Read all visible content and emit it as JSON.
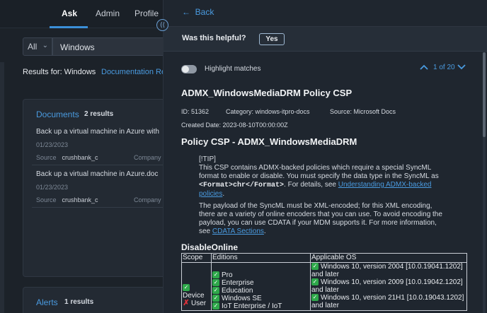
{
  "nav": {
    "tabs": [
      "Ask",
      "Admin",
      "Profile"
    ],
    "active_tab": "Ask"
  },
  "search": {
    "filter": "All",
    "query": "Windows"
  },
  "results": {
    "label": "Results for: Windows",
    "link": "Documentation Re"
  },
  "documents_panel": {
    "title": "Documents",
    "count": "2 results",
    "items": [
      {
        "title": "Back up a virtual machine in Azure with",
        "date": "01/23/2023",
        "source_label": "Source",
        "source": "crushbank_c",
        "company_label": "Company"
      },
      {
        "title": "Back up a virtual machine in Azure.doc",
        "date": "01/23/2023",
        "source_label": "Source",
        "source": "crushbank_c",
        "company_label": "Company"
      }
    ]
  },
  "alerts_panel": {
    "title": "Alerts",
    "count": "1 results"
  },
  "drawer": {
    "back_label": "Back",
    "helpful_question": "Was this helpful?",
    "yes_label": "Yes",
    "highlight_label": "Highlight matches",
    "highlight_on": false,
    "match_position": "1 of 20",
    "doc_title": "ADMX_WindowsMediaDRM Policy CSP",
    "id_text": "ID: 51362",
    "category_text": "Category: windows-itpro-docs",
    "source_text": "Source: Microsoft Docs",
    "created_text": "Created Date: 2023-08-10T00:00:00Z",
    "csp_title": "Policy CSP - ADMX_WindowsMediaDRM",
    "tip": "[!TIP]",
    "para1_a": "This CSP contains ADMX-backed policies which require a special SyncML format to enable or disable. You must specify the data type in the SyncML as ",
    "para1_code": "<Format>chr</Format>",
    "para1_b": ". For details, see ",
    "para1_link": "Understanding ADMX-backed policies",
    "para1_c": ".",
    "para2_a": "The payload of the SyncML must be XML-encoded; for this XML encoding, there are a variety of online encoders that you can use. To avoid encoding the payload, you can use CDATA if your MDM supports it. For more information, see ",
    "para2_link": "CDATA Sections",
    "para2_b": ".",
    "section_title": "DisableOnline",
    "table": {
      "headers": [
        "Scope",
        "Editions",
        "Applicable OS"
      ],
      "scope": [
        "Device",
        "User"
      ],
      "editions": [
        "Pro",
        "Enterprise",
        "Education",
        "Windows SE",
        "IoT Enterprise / IoT"
      ],
      "os": [
        "Windows 10, version 2004 [10.0.19041.1202] and later",
        "Windows 10, version 2009 [10.0.19042.1202] and later",
        "Windows 10, version 21H1 [10.0.19043.1202] and later"
      ]
    }
  },
  "colors": {
    "accent": "#4a9be0",
    "background": "#1f262f",
    "check_green": "#2ea84a",
    "cross_red": "#e0323a"
  }
}
